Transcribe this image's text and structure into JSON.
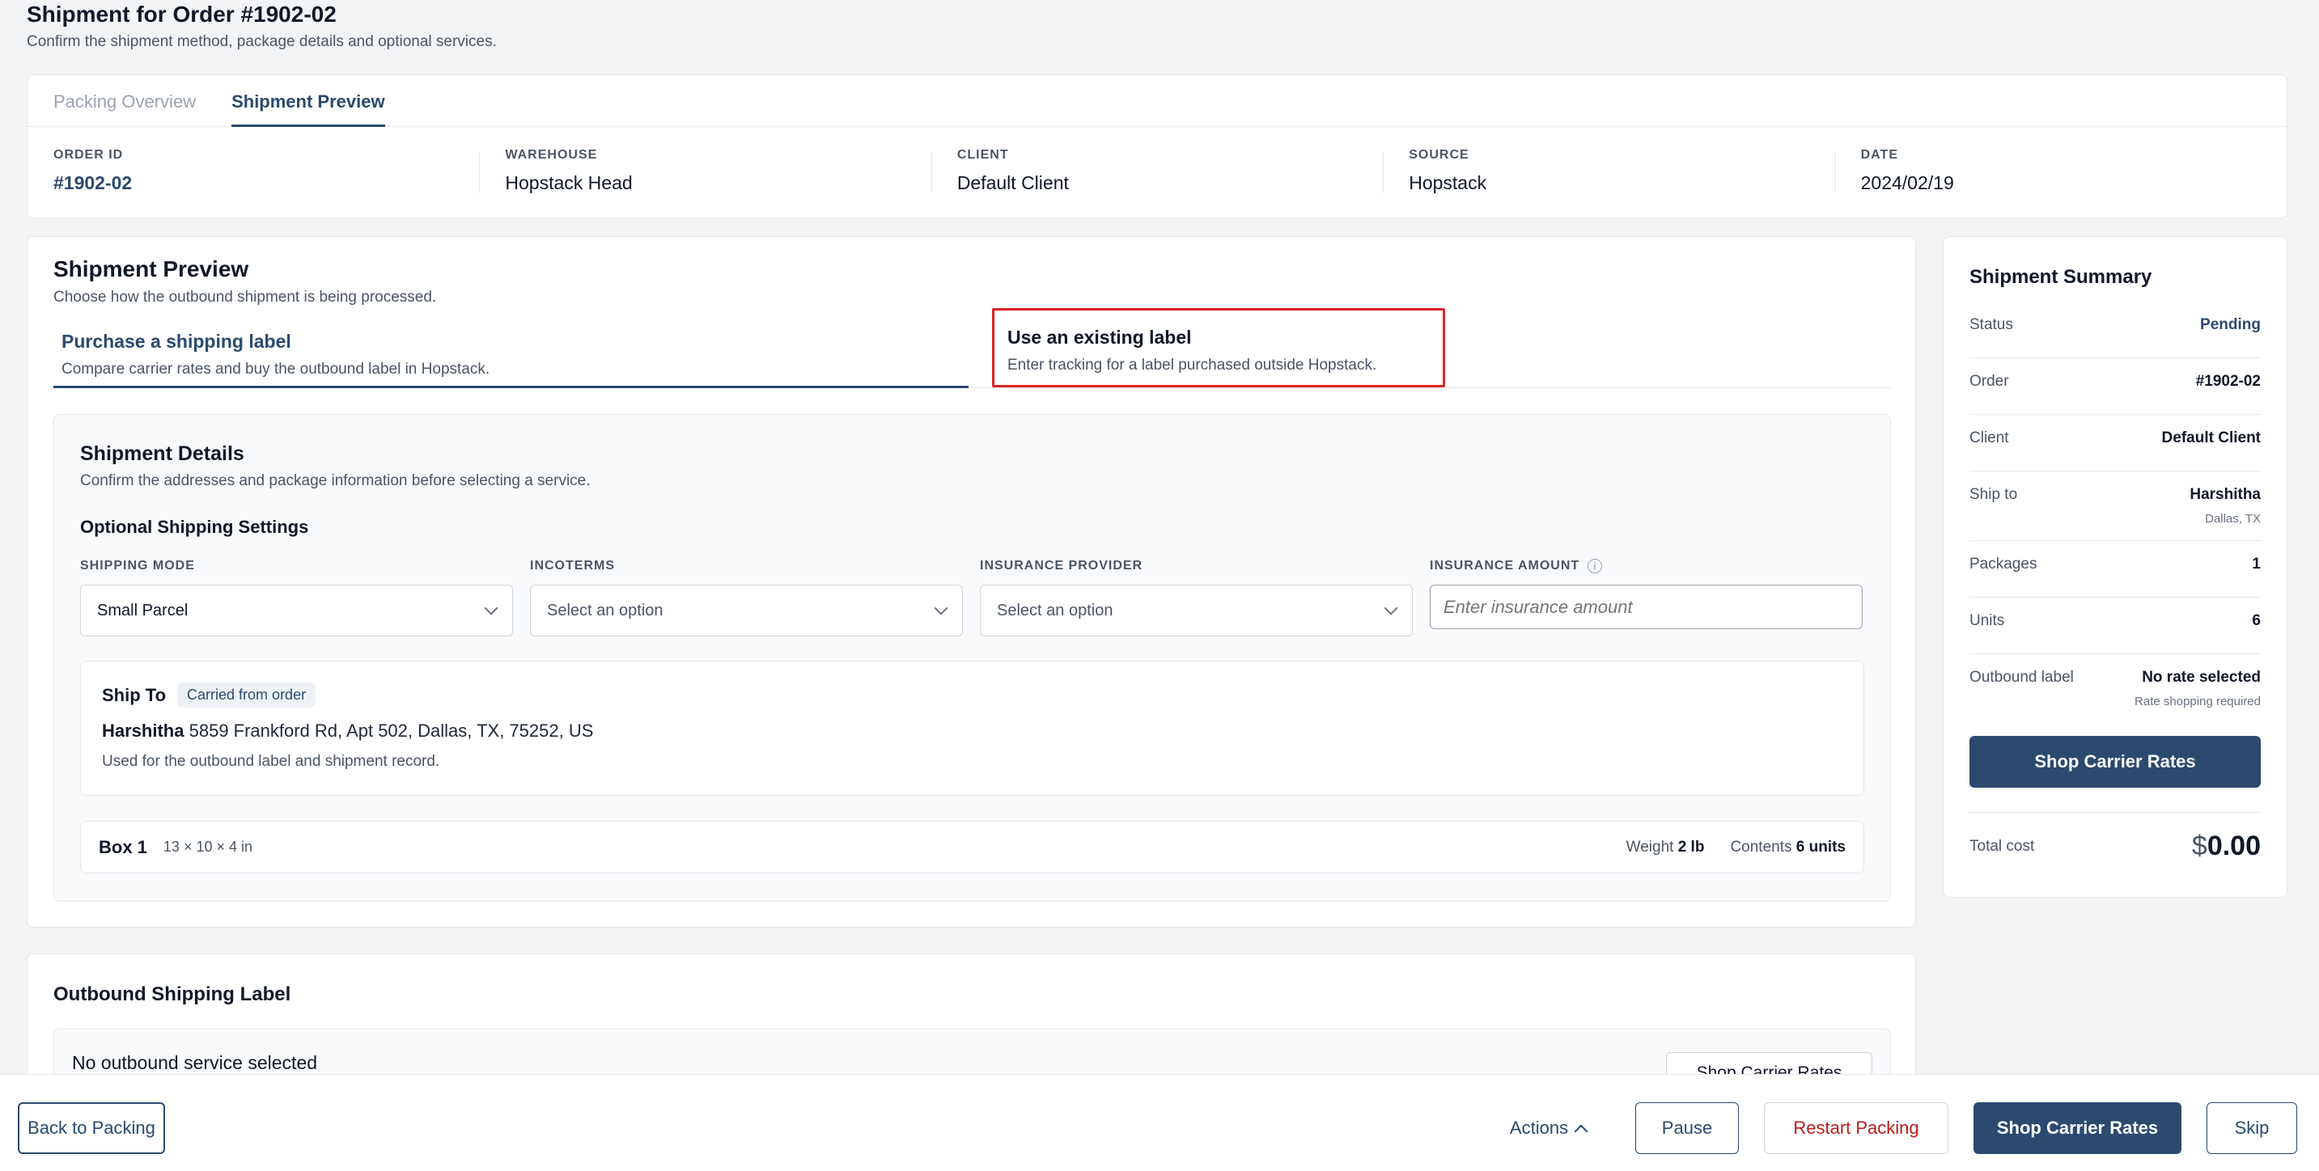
{
  "page": {
    "title": "Shipment for Order #1902-02",
    "subtitle": "Confirm the shipment method, package details and optional services."
  },
  "top_tabs": [
    "Packing Overview",
    "Shipment Preview"
  ],
  "meta": [
    {
      "label": "ORDER ID",
      "value": "#1902-02"
    },
    {
      "label": "WAREHOUSE",
      "value": "Hopstack Head"
    },
    {
      "label": "CLIENT",
      "value": "Default Client"
    },
    {
      "label": "SOURCE",
      "value": "Hopstack"
    },
    {
      "label": "DATE",
      "value": "2024/02/19"
    }
  ],
  "preview": {
    "title": "Shipment Preview",
    "subtitle": "Choose how the outbound shipment is being processed.",
    "methods": [
      {
        "title": "Purchase a shipping label",
        "subtitle": "Compare carrier rates and buy the outbound label in Hopstack."
      },
      {
        "title": "Use an existing label",
        "subtitle": "Enter tracking for a label purchased outside Hopstack."
      }
    ]
  },
  "details": {
    "title": "Shipment Details",
    "subtitle": "Confirm the addresses and package information before selecting a service.",
    "optional_title": "Optional Shipping Settings",
    "fields": [
      {
        "label": "SHIPPING MODE",
        "value": "Small Parcel"
      },
      {
        "label": "INCOTERMS",
        "value": "Select an option"
      },
      {
        "label": "INSURANCE PROVIDER",
        "value": "Select an option"
      },
      {
        "label": "INSURANCE AMOUNT",
        "placeholder": "Enter insurance amount"
      }
    ]
  },
  "ship_to": {
    "title": "Ship To",
    "badge": "Carried from order",
    "name": "Harshitha",
    "address": "5859 Frankford Rd, Apt 502, Dallas, TX, 75252, US",
    "note": "Used for the outbound label and shipment record."
  },
  "box": {
    "name": "Box 1",
    "dims": "13 × 10 × 4 in",
    "weight_label": "Weight",
    "weight": "2 lb",
    "contents_label": "Contents",
    "contents": "6 units"
  },
  "outbound": {
    "title": "Outbound Shipping Label",
    "message": "No outbound service selected",
    "button": "Shop Carrier Rates"
  },
  "summary": {
    "title": "Shipment Summary",
    "rows": [
      {
        "label": "Status",
        "value": "Pending"
      },
      {
        "label": "Order",
        "value": "#1902-02"
      },
      {
        "label": "Client",
        "value": "Default Client"
      },
      {
        "label": "Ship to",
        "value": "Harshitha",
        "sub": "Dallas, TX"
      },
      {
        "label": "Packages",
        "value": "1"
      },
      {
        "label": "Units",
        "value": "6"
      },
      {
        "label": "Outbound label",
        "value": "No rate selected",
        "sub": "Rate shopping required"
      }
    ],
    "button": "Shop Carrier Rates",
    "total_label": "Total cost",
    "total_currency": "$",
    "total_value": "0.00"
  },
  "bottom_bar": {
    "back": "Back to Packing",
    "actions": "Actions",
    "pause": "Pause",
    "restart": "Restart Packing",
    "shop": "Shop Carrier Rates",
    "skip": "Skip"
  },
  "colors": {
    "accent": "#2b4a6f",
    "danger": "#b91c1c",
    "highlight_border": "#dc2626"
  }
}
